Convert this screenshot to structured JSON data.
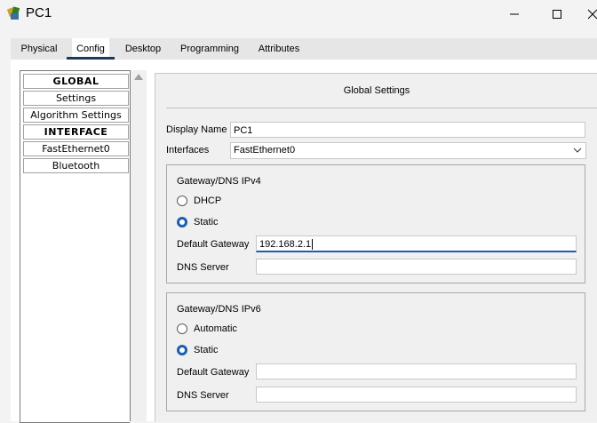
{
  "window": {
    "title": "PC1",
    "app_icon": "packet-tracer-pc-icon",
    "controls": [
      "minimize-icon",
      "maximize-icon",
      "close-icon"
    ]
  },
  "tabs": [
    {
      "label": "Physical",
      "active": false
    },
    {
      "label": "Config",
      "active": true
    },
    {
      "label": "Desktop",
      "active": false
    },
    {
      "label": "Programming",
      "active": false
    },
    {
      "label": "Attributes",
      "active": false
    }
  ],
  "sidebar": {
    "items": [
      {
        "label": "GLOBAL",
        "header": true
      },
      {
        "label": "Settings",
        "header": false
      },
      {
        "label": "Algorithm Settings",
        "header": false
      },
      {
        "label": "INTERFACE",
        "header": true
      },
      {
        "label": "FastEthernet0",
        "header": false
      },
      {
        "label": "Bluetooth",
        "header": false
      }
    ]
  },
  "global_settings": {
    "title": "Global Settings",
    "display_name_label": "Display Name",
    "display_name_value": "PC1",
    "interfaces_label": "Interfaces",
    "interfaces_value": "FastEthernet0"
  },
  "ipv4": {
    "title": "Gateway/DNS IPv4",
    "option_dhcp": "DHCP",
    "option_static": "Static",
    "selected": "Static",
    "gateway_label": "Default Gateway",
    "gateway_value": "192.168.2.1",
    "dns_label": "DNS Server",
    "dns_value": ""
  },
  "ipv6": {
    "title": "Gateway/DNS IPv6",
    "option_auto": "Automatic",
    "option_static": "Static",
    "selected": "Static",
    "gateway_label": "Default Gateway",
    "gateway_value": "",
    "dns_label": "DNS Server",
    "dns_value": ""
  },
  "colors": {
    "accent": "#1a5fb4",
    "tab_underline": "#1b3a5b",
    "panel_bg": "#f0f0f0"
  }
}
